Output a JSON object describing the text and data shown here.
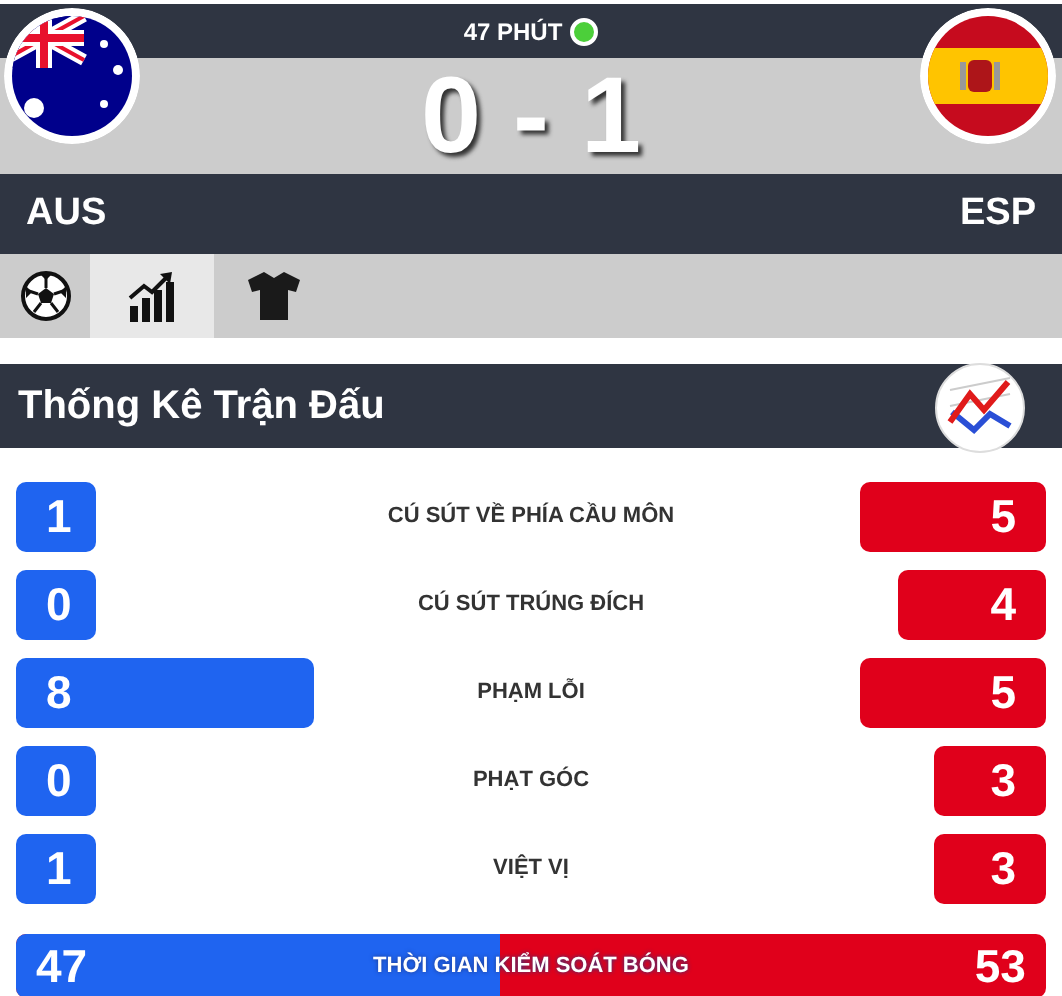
{
  "match": {
    "minute": "47 PHÚT",
    "live": true,
    "home_score": "0",
    "separator": "-",
    "away_score": "1",
    "home_team": "AUS",
    "away_team": "ESP"
  },
  "tabs": [
    {
      "kind": "ball",
      "selected": false
    },
    {
      "kind": "chart",
      "selected": true
    },
    {
      "kind": "shirt",
      "selected": false
    }
  ],
  "section_title": "Thống Kê Trận Đấu",
  "stats": [
    {
      "label": "CÚ SÚT VỀ PHÍA CẦU MÔN",
      "home": "1",
      "away": "5"
    },
    {
      "label": "CÚ SÚT TRÚNG ĐÍCH",
      "home": "0",
      "away": "4"
    },
    {
      "label": "PHẠM LỖI",
      "home": "8",
      "away": "5"
    },
    {
      "label": "PHẠT GÓC",
      "home": "0",
      "away": "3"
    },
    {
      "label": "VIỆT VỊ",
      "home": "1",
      "away": "3"
    }
  ],
  "possession": {
    "label": "THỜI GIAN KIỂM SOÁT BÓNG",
    "home": "47",
    "away": "53",
    "level": 0.47
  }
}
